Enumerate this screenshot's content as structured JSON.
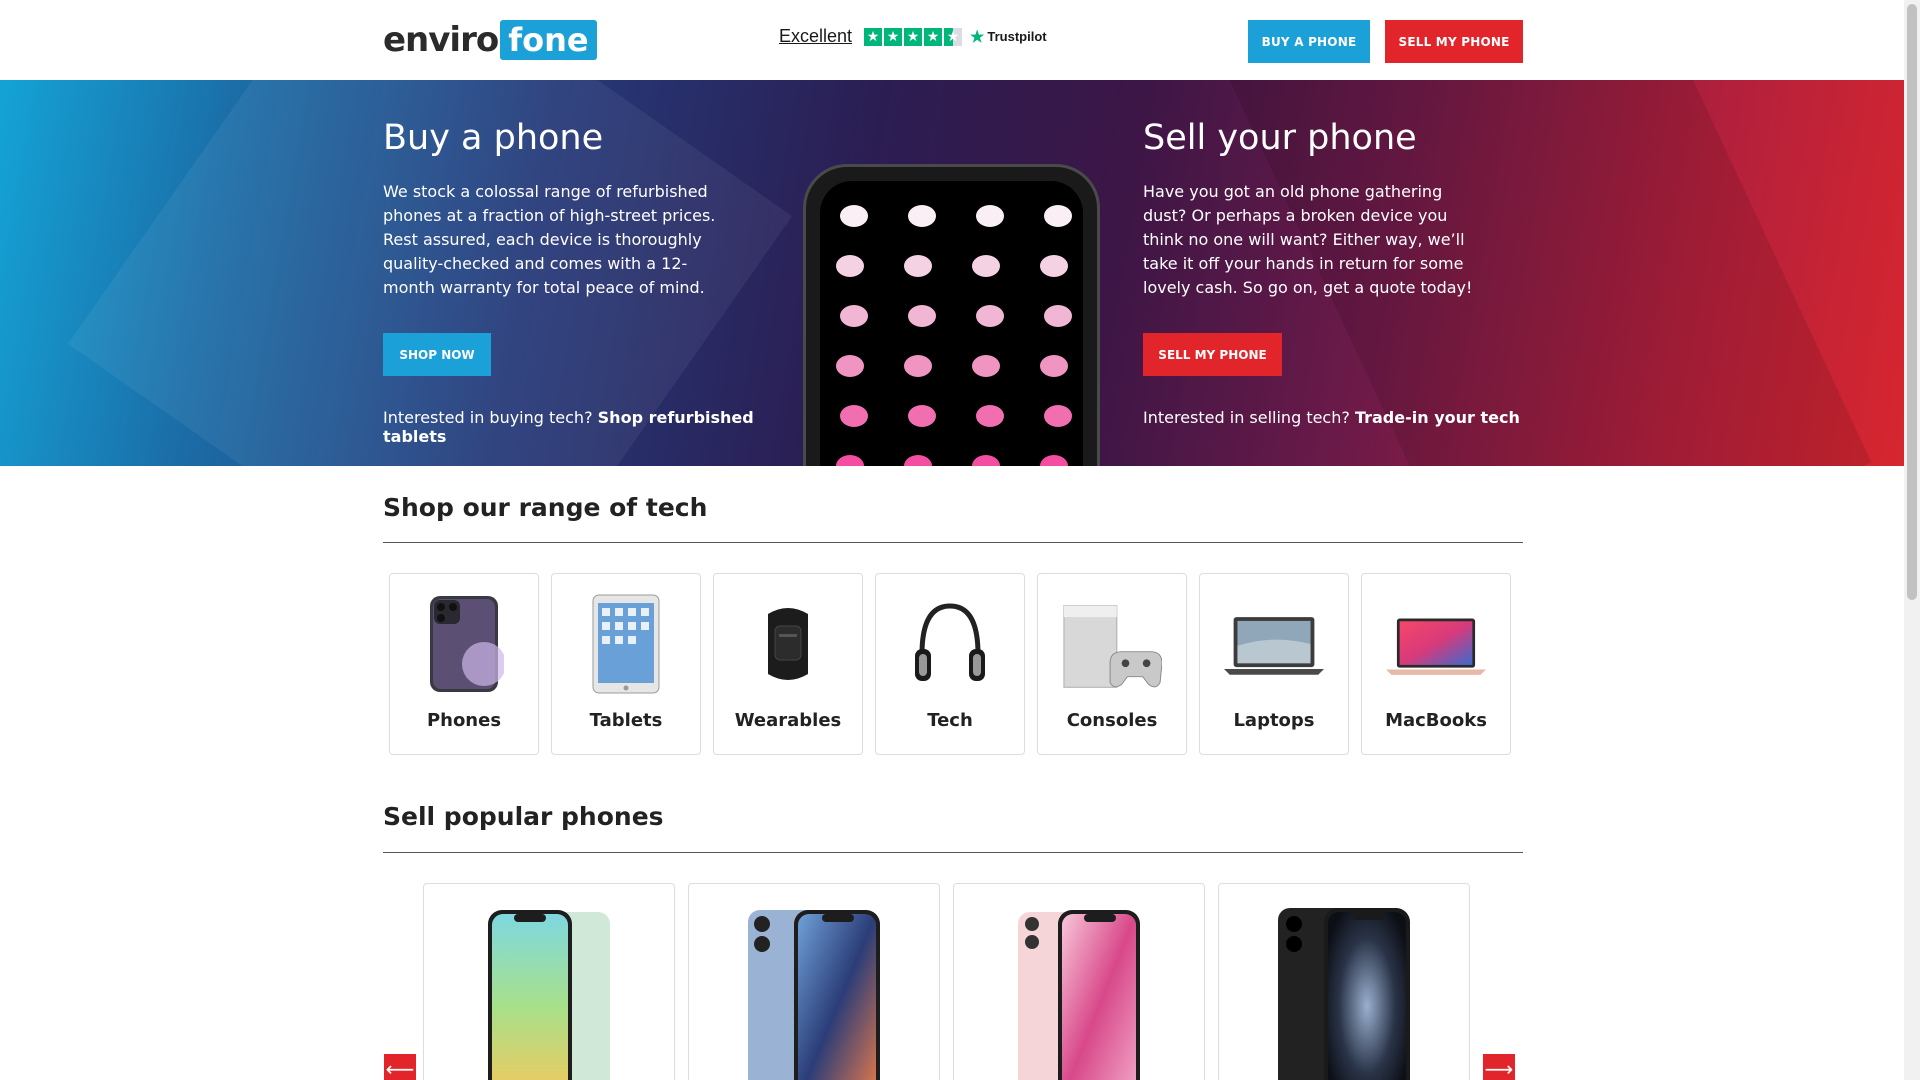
{
  "header": {
    "logo_part1": "enviro",
    "logo_part2": "fone",
    "trustpilot_rating": "Excellent",
    "trustpilot_brand": "Trustpilot",
    "buy_button": "BUY A PHONE",
    "sell_button": "SELL MY PHONE"
  },
  "hero": {
    "buy": {
      "title": "Buy a phone",
      "text": "We stock a colossal range of refurbished phones at a fraction of high-street prices. Rest assured, each device is thoroughly quality-checked and comes with a 12-month warranty for total peace of mind.",
      "button": "SHOP NOW",
      "link_prefix": "Interested in buying tech?",
      "link_text": "Shop refurbished tablets"
    },
    "sell": {
      "title": "Sell your phone",
      "text": "Have you got an old phone gathering dust? Or perhaps a broken device you think no one will want? Either way, we’ll take it off your hands in return for some lovely cash. So go on, get a quote today!",
      "button": "SELL MY PHONE",
      "link_prefix": "Interested in selling tech?",
      "link_text": "Trade-in your tech"
    }
  },
  "shop": {
    "title": "Shop our range of tech",
    "categories": [
      {
        "label": "Phones",
        "icon": "phone-icon"
      },
      {
        "label": "Tablets",
        "icon": "tablet-icon"
      },
      {
        "label": "Wearables",
        "icon": "wearable-icon"
      },
      {
        "label": "Tech",
        "icon": "headphones-icon"
      },
      {
        "label": "Consoles",
        "icon": "console-icon"
      },
      {
        "label": "Laptops",
        "icon": "laptop-icon"
      },
      {
        "label": "MacBooks",
        "icon": "macbook-icon"
      }
    ]
  },
  "sell_popular": {
    "title": "Sell popular phones",
    "prev_arrow": "⟵",
    "next_arrow": "⟶"
  },
  "colors": {
    "brand_blue": "#1ba0d8",
    "brand_red": "#e2252b",
    "trustpilot_green": "#00b67a"
  }
}
